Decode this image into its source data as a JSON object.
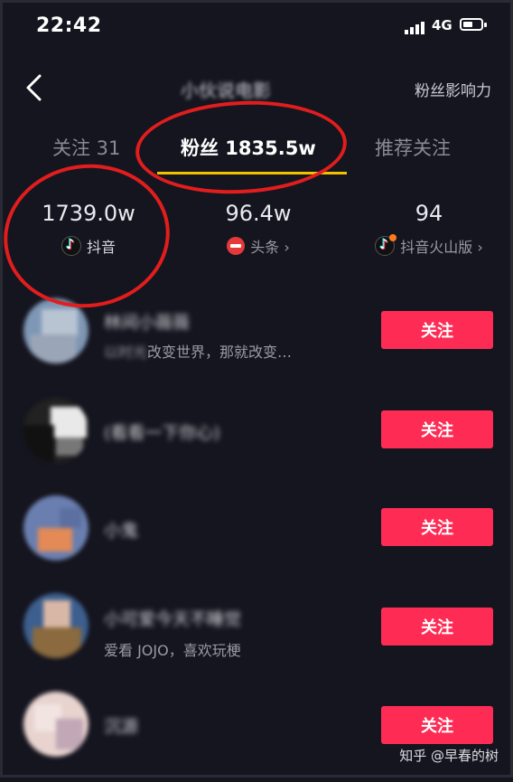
{
  "status_bar": {
    "time": "22:42",
    "network": "4G"
  },
  "header": {
    "title": "小伙说电影",
    "influence_link": "粉丝影响力"
  },
  "tabs": [
    {
      "label": "关注 31"
    },
    {
      "label": "粉丝 1835.5w"
    },
    {
      "label": "推荐关注"
    }
  ],
  "stats": [
    {
      "value": "1739.0w",
      "platform": "抖音"
    },
    {
      "value": "96.4w",
      "platform": "头条 ›"
    },
    {
      "value": "94",
      "platform": "抖音火山版 ›"
    }
  ],
  "fans": [
    {
      "name": "林间小薇薇",
      "bio_blur": "以时光",
      "bio": "改变世界，那就改变…",
      "follow_label": "关注"
    },
    {
      "name": "(看看一下你心)",
      "follow_label": "关注"
    },
    {
      "name": "小鬼",
      "follow_label": "关注"
    },
    {
      "name": "小可爱今天不睡觉",
      "bio": "爱看 JOJO，喜欢玩梗",
      "follow_label": "关注"
    },
    {
      "name": "沉源",
      "follow_label": "关注"
    }
  ],
  "watermark": "知乎 @早春的树",
  "colors": {
    "accent": "#fe2c55",
    "tab_underline": "#f2c200",
    "highlight_circle": "#e11d1d"
  }
}
